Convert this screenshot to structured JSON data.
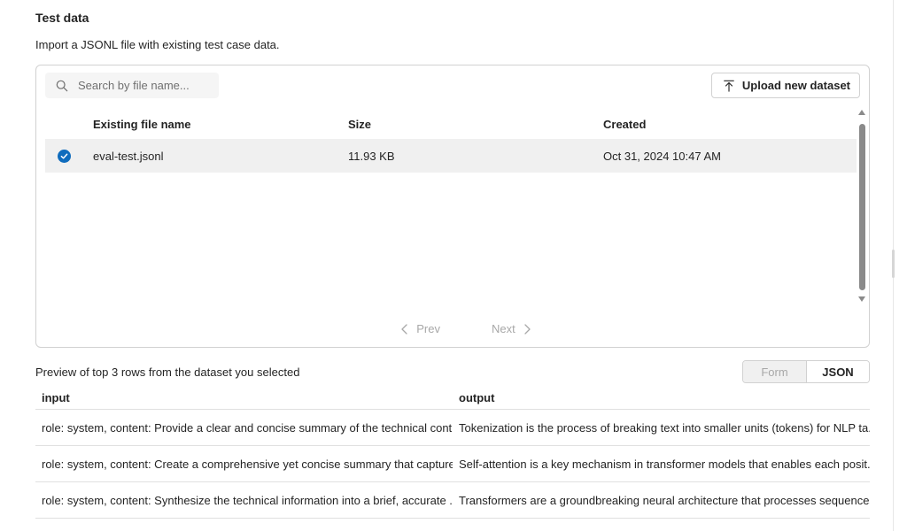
{
  "section": {
    "title": "Test data",
    "description": "Import a JSONL file with existing test case data."
  },
  "search": {
    "placeholder": "Search by file name..."
  },
  "upload_button": {
    "label": "Upload new dataset"
  },
  "file_table": {
    "columns": [
      "Existing file name",
      "Size",
      "Created"
    ],
    "rows": [
      {
        "selected": true,
        "name": "eval-test.jsonl",
        "size": "11.93 KB",
        "created": "Oct 31, 2024 10:47 AM"
      }
    ]
  },
  "pager": {
    "prev_label": "Prev",
    "next_label": "Next"
  },
  "preview": {
    "label": "Preview of top 3 rows from the dataset you selected",
    "toggle": {
      "form": "Form",
      "json": "JSON",
      "active": "JSON"
    },
    "columns": [
      "input",
      "output"
    ],
    "rows": [
      {
        "input": "role: system, content: Provide a clear and concise summary of the technical cont...",
        "output": "Tokenization is the process of breaking text into smaller units (tokens) for NLP ta..."
      },
      {
        "input": "role: system, content: Create a comprehensive yet concise summary that capture...",
        "output": "Self-attention is a key mechanism in transformer models that enables each posit..."
      },
      {
        "input": "role: system, content: Synthesize the technical information into a brief, accurate ...",
        "output": "Transformers are a groundbreaking neural architecture that processes sequences..."
      }
    ]
  },
  "colors": {
    "accent": "#0f6cbd",
    "selected_row": "#f0f0f0",
    "border": "#d1d1d1"
  },
  "icons": [
    "search-icon",
    "upload-icon",
    "checkmark-icon",
    "chevron-left-icon",
    "chevron-right-icon"
  ]
}
